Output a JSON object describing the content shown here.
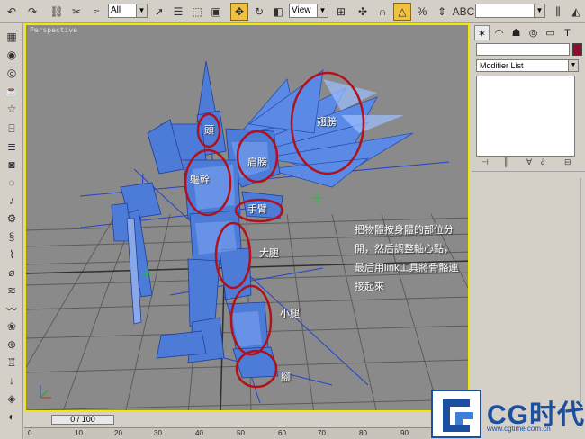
{
  "toolbar": {
    "selection_filter": "All",
    "reference_coord": "View",
    "named_selection": ""
  },
  "viewport": {
    "label": "Perspective",
    "annotations": [
      "翅膀",
      "頭",
      "肩膀",
      "軀幹",
      "手臂",
      "大腿",
      "小腿",
      "腳"
    ],
    "note_lines": [
      "把物體按身體的部位分",
      "開，然后調整軸心點，",
      "最后用link工具將骨骼連",
      "接起來"
    ]
  },
  "command_panel": {
    "modifier_list": "Modifier List"
  },
  "timeline": {
    "frame_display": "0 / 100",
    "ruler_labels": [
      "0",
      "10",
      "20",
      "30",
      "40",
      "50",
      "60",
      "70",
      "80",
      "90",
      "100"
    ]
  },
  "watermark": {
    "brand": "CG时代",
    "url": "www.cgtime.com.cn"
  }
}
